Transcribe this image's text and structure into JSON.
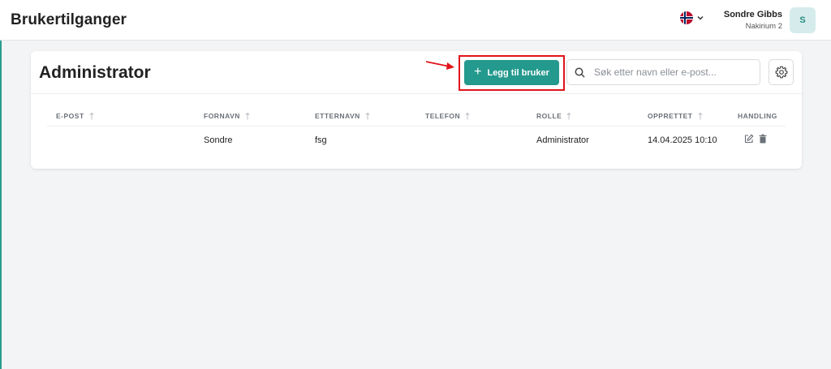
{
  "header": {
    "title": "Brukertilganger",
    "language_icon": "norway-flag-icon",
    "user_name": "Sondre Gibbs",
    "user_org": "Nakirium 2",
    "avatar_initial": "S"
  },
  "section": {
    "title": "Administrator",
    "add_button_label": "Legg til bruker",
    "search_placeholder": "Søk etter navn eller e-post...",
    "search_value": ""
  },
  "table": {
    "columns": [
      "E-POST",
      "FORNAVN",
      "ETTERNAVN",
      "TELEFON",
      "ROLLE",
      "OPPRETTET",
      "HANDLING"
    ],
    "rows": [
      {
        "email": "",
        "first_name": "Sondre",
        "last_name": "fsg",
        "phone": "",
        "role": "Administrator",
        "created": "14.04.2025 10:10"
      }
    ]
  },
  "colors": {
    "accent": "#24998d",
    "highlight_annotation": "#e0141b",
    "avatar_bg": "#d6ecec"
  }
}
